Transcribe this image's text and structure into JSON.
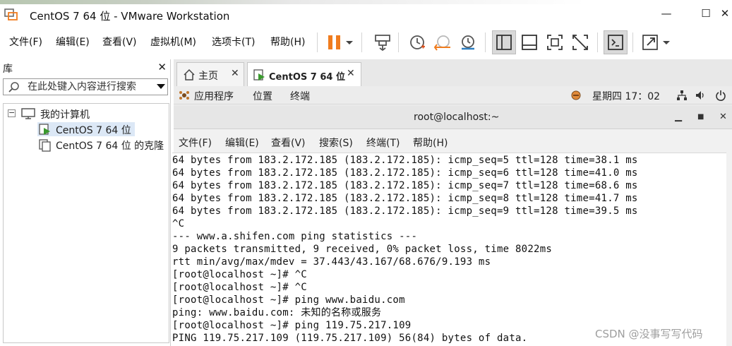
{
  "window": {
    "title": "CentOS 7 64 位 - VMware Workstation",
    "minimize_glyph": "—",
    "maximize_glyph": "☐",
    "close_glyph": "✕"
  },
  "menubar": {
    "items": [
      "文件(F)",
      "编辑(E)",
      "查看(V)",
      "虚拟机(M)",
      "选项卡(T)",
      "帮助(H)"
    ]
  },
  "toolbar": {
    "icons": [
      "pause-icon",
      "dropdown-icon",
      "send-keys-icon",
      "snapshot-icon",
      "revert-snapshot-icon",
      "snapshot-manager-icon",
      "library-view-icon",
      "thumbnail-view-icon",
      "full-screen-icon",
      "unity-icon",
      "console-view-icon",
      "stretch-icon"
    ],
    "accent_color": "#f07c1e"
  },
  "library": {
    "title": "库",
    "close_glyph": "✕",
    "search_placeholder": "在此处键入内容进行搜索",
    "tree": {
      "root": "我的计算机",
      "items": [
        "CentOS 7 64 位",
        "CentOS 7 64 位 的克隆"
      ]
    }
  },
  "tabs": [
    {
      "label": "主页",
      "active": false
    },
    {
      "label": "CentOS 7 64 位",
      "active": true
    }
  ],
  "gnome": {
    "apps": "应用程序",
    "places": "位置",
    "terminal": "终端",
    "clock": "星期四 17：02"
  },
  "terminal": {
    "title": "root@localhost:~",
    "menu": [
      "文件(F)",
      "编辑(E)",
      "查看(V)",
      "搜索(S)",
      "终端(T)",
      "帮助(H)"
    ],
    "lines": [
      "64 bytes from 183.2.172.185 (183.2.172.185): icmp_seq=5 ttl=128 time=38.1 ms",
      "64 bytes from 183.2.172.185 (183.2.172.185): icmp_seq=6 ttl=128 time=41.0 ms",
      "64 bytes from 183.2.172.185 (183.2.172.185): icmp_seq=7 ttl=128 time=68.6 ms",
      "64 bytes from 183.2.172.185 (183.2.172.185): icmp_seq=8 ttl=128 time=41.7 ms",
      "64 bytes from 183.2.172.185 (183.2.172.185): icmp_seq=9 ttl=128 time=39.5 ms",
      "^C",
      "--- www.a.shifen.com ping statistics ---",
      "9 packets transmitted, 9 received, 0% packet loss, time 8022ms",
      "rtt min/avg/max/mdev = 37.443/43.167/68.676/9.193 ms",
      "[root@localhost ~]# ^C",
      "[root@localhost ~]# ^C",
      "[root@localhost ~]# ping www.baidu.com",
      "ping: www.baidu.com: 未知的名称或服务",
      "[root@localhost ~]# ping 119.75.217.109",
      "PING 119.75.217.109 (119.75.217.109) 56(84) bytes of data."
    ]
  },
  "watermark": "CSDN @没事写写代码"
}
